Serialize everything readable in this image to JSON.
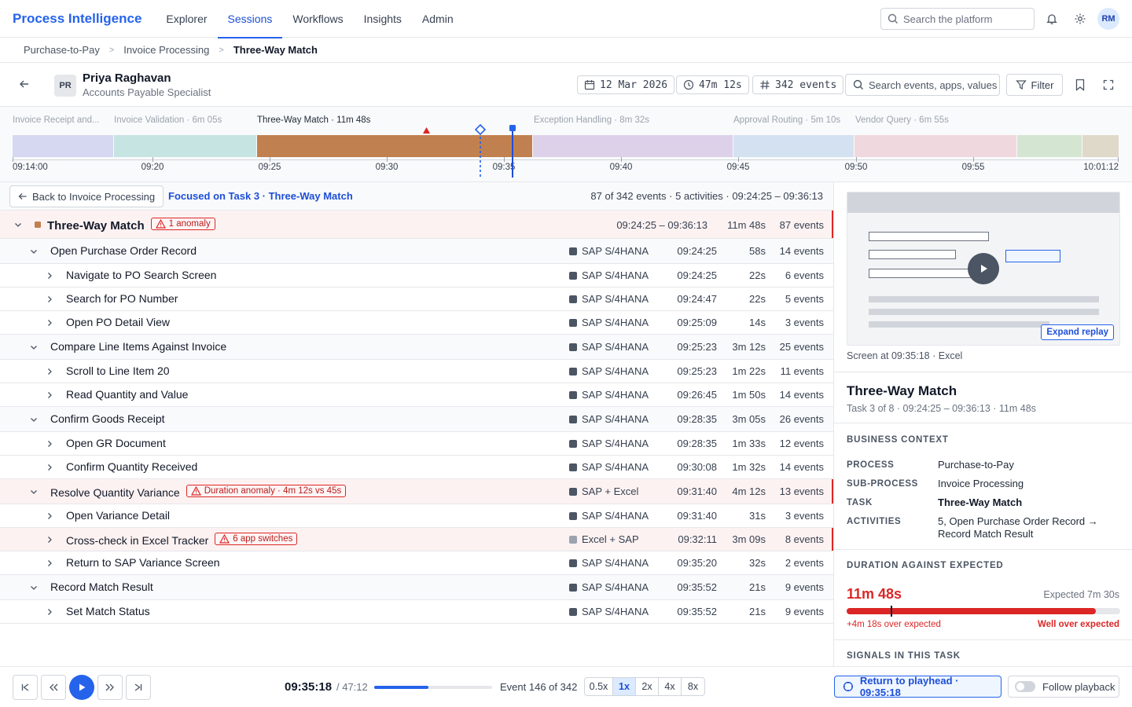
{
  "app": {
    "brand": "Process Intelligence",
    "nav": [
      {
        "label": "Explorer",
        "active": false
      },
      {
        "label": "Sessions",
        "active": true
      },
      {
        "label": "Workflows",
        "active": false
      },
      {
        "label": "Insights",
        "active": false
      },
      {
        "label": "Admin",
        "active": false
      }
    ],
    "search_placeholder": "Search the platform",
    "user_initials": "RM"
  },
  "breadcrumb": [
    "Purchase-to-Pay",
    "Invoice Processing",
    "Three-Way Match"
  ],
  "session": {
    "initials": "PR",
    "name": "Priya Raghavan",
    "role": "Accounts Payable Specialist",
    "date": "12 Mar 2026",
    "duration": "47m 12s",
    "events": "342 events",
    "search_placeholder": "Search events, apps, values",
    "filter_label": "Filter"
  },
  "timeline": {
    "segments": [
      {
        "label": "Invoice Receipt and...",
        "color": "#d5d8f0",
        "active": false
      },
      {
        "label": "Invoice Validation · 6m 05s",
        "color": "#c6e4e2",
        "active": false
      },
      {
        "label": "Three-Way Match · 11m 48s",
        "color": "#c1804f",
        "active": true
      },
      {
        "label": "Exception Handling · 8m 32s",
        "color": "#ddd1ea",
        "active": false
      },
      {
        "label": "Approval Routing · 5m 10s",
        "color": "#d3e1f1",
        "active": false
      },
      {
        "label": "Vendor Query · 6m 55s",
        "color": "#f0d9de",
        "active": false
      },
      {
        "label": "",
        "color": "#d4e6d2",
        "active": false
      },
      {
        "label": "",
        "color": "#ded9c9",
        "active": false
      }
    ],
    "ticks": [
      "09:14:00",
      "09:20",
      "09:25",
      "09:30",
      "09:35",
      "09:40",
      "09:45",
      "09:50",
      "09:55",
      "10:01:12"
    ]
  },
  "focus": {
    "back_label": "Back to Invoice Processing",
    "label": "Focused on Task 3 · Three-Way Match",
    "stats": "87 of 342 events · 5 activities · 09:24:25 – 09:36:13"
  },
  "tree": {
    "task": {
      "name": "Three-Way Match",
      "badge": "1 anomaly",
      "time": "09:24:25 – 09:36:13",
      "duration": "11m 48s",
      "events": "87 events"
    },
    "rows": [
      {
        "level": "sub",
        "name": "Open Purchase Order Record",
        "app": "SAP S/4HANA",
        "time": "09:24:25",
        "duration": "58s",
        "events": "14 events",
        "badge": "",
        "anomaly": false,
        "light": false
      },
      {
        "level": "leaf",
        "name": "Navigate to PO Search Screen",
        "app": "SAP S/4HANA",
        "time": "09:24:25",
        "duration": "22s",
        "events": "6 events",
        "badge": "",
        "anomaly": false,
        "light": false
      },
      {
        "level": "leaf",
        "name": "Search for PO Number",
        "app": "SAP S/4HANA",
        "time": "09:24:47",
        "duration": "22s",
        "events": "5 events",
        "badge": "",
        "anomaly": false,
        "light": false
      },
      {
        "level": "leaf",
        "name": "Open PO Detail View",
        "app": "SAP S/4HANA",
        "time": "09:25:09",
        "duration": "14s",
        "events": "3 events",
        "badge": "",
        "anomaly": false,
        "light": false
      },
      {
        "level": "sub",
        "name": "Compare Line Items Against Invoice",
        "app": "SAP S/4HANA",
        "time": "09:25:23",
        "duration": "3m 12s",
        "events": "25 events",
        "badge": "",
        "anomaly": false,
        "light": false
      },
      {
        "level": "leaf",
        "name": "Scroll to Line Item 20",
        "app": "SAP S/4HANA",
        "time": "09:25:23",
        "duration": "1m 22s",
        "events": "11 events",
        "badge": "",
        "anomaly": false,
        "light": false
      },
      {
        "level": "leaf",
        "name": "Read Quantity and Value",
        "app": "SAP S/4HANA",
        "time": "09:26:45",
        "duration": "1m 50s",
        "events": "14 events",
        "badge": "",
        "anomaly": false,
        "light": false
      },
      {
        "level": "sub",
        "name": "Confirm Goods Receipt",
        "app": "SAP S/4HANA",
        "time": "09:28:35",
        "duration": "3m 05s",
        "events": "26 events",
        "badge": "",
        "anomaly": false,
        "light": false
      },
      {
        "level": "leaf",
        "name": "Open GR Document",
        "app": "SAP S/4HANA",
        "time": "09:28:35",
        "duration": "1m 33s",
        "events": "12 events",
        "badge": "",
        "anomaly": false,
        "light": false
      },
      {
        "level": "leaf",
        "name": "Confirm Quantity Received",
        "app": "SAP S/4HANA",
        "time": "09:30:08",
        "duration": "1m 32s",
        "events": "14 events",
        "badge": "",
        "anomaly": false,
        "light": false
      },
      {
        "level": "sub",
        "name": "Resolve Quantity Variance",
        "app": "SAP + Excel",
        "time": "09:31:40",
        "duration": "4m 12s",
        "events": "13 events",
        "badge": "Duration anomaly · 4m 12s vs 45s",
        "anomaly": true,
        "light": false
      },
      {
        "level": "leaf",
        "name": "Open Variance Detail",
        "app": "SAP S/4HANA",
        "time": "09:31:40",
        "duration": "31s",
        "events": "3 events",
        "badge": "",
        "anomaly": false,
        "light": false
      },
      {
        "level": "leaf",
        "name": "Cross-check in Excel Tracker",
        "app": "Excel + SAP",
        "time": "09:32:11",
        "duration": "3m 09s",
        "events": "8 events",
        "badge": "6 app switches",
        "anomaly": true,
        "light": true
      },
      {
        "level": "leaf",
        "name": "Return to SAP Variance Screen",
        "app": "SAP S/4HANA",
        "time": "09:35:20",
        "duration": "32s",
        "events": "2 events",
        "badge": "",
        "anomaly": false,
        "light": false
      },
      {
        "level": "sub",
        "name": "Record Match Result",
        "app": "SAP S/4HANA",
        "time": "09:35:52",
        "duration": "21s",
        "events": "9 events",
        "badge": "",
        "anomaly": false,
        "light": false
      },
      {
        "level": "leaf",
        "name": "Set Match Status",
        "app": "SAP S/4HANA",
        "time": "09:35:52",
        "duration": "21s",
        "events": "9 events",
        "badge": "",
        "anomaly": false,
        "light": false
      }
    ]
  },
  "panel": {
    "expand_label": "Expand replay",
    "screen_caption": "Screen at 09:35:18 · Excel",
    "title": "Three-Way Match",
    "subtitle": "Task 3 of 8 · 09:24:25 – 09:36:13 · 11m 48s",
    "context_head": "BUSINESS CONTEXT",
    "context": [
      {
        "key": "PROCESS",
        "value": "Purchase-to-Pay",
        "bold": false
      },
      {
        "key": "SUB-PROCESS",
        "value": "Invoice Processing",
        "bold": false
      },
      {
        "key": "TASK",
        "value": "Three-Way Match",
        "bold": true
      },
      {
        "key": "ACTIVITIES",
        "value": "5, Open Purchase Order Record → Record Match Result",
        "bold": false
      }
    ],
    "duration_head": "DURATION AGAINST EXPECTED",
    "actual": "11m 48s",
    "expected": "Expected 7m 30s",
    "progress_fraction": 0.91,
    "expected_fraction": 0.16,
    "over": "+4m 18s over expected",
    "verdict": "Well over expected",
    "signals_head": "SIGNALS IN THIS TASK"
  },
  "playback": {
    "current": "09:35:18",
    "total": "/ 47:12",
    "progress_fraction": 0.46,
    "event_label": "Event 146 of 342",
    "speeds": [
      {
        "label": "0.5x",
        "active": false
      },
      {
        "label": "1x",
        "active": true
      },
      {
        "label": "2x",
        "active": false
      },
      {
        "label": "4x",
        "active": false
      },
      {
        "label": "8x",
        "active": false
      }
    ],
    "return_label": "Return to playhead · 09:35:18",
    "follow_label": "Follow playback"
  },
  "colors": {
    "accent": "#2563eb",
    "anomaly": "#dc2626"
  }
}
